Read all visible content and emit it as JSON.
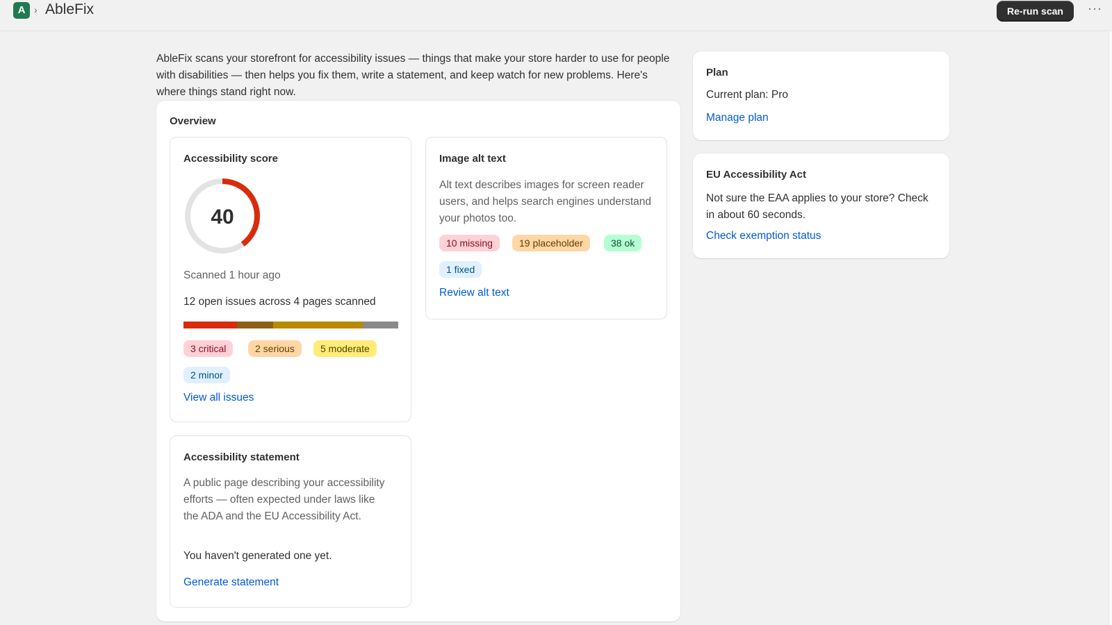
{
  "app": {
    "logo_letter": "A",
    "title": "AbleFix"
  },
  "header": {
    "rerun_label": "Re-run scan",
    "more_label": "···"
  },
  "intro": "AbleFix scans your storefront for accessibility issues — things that make your store harder to use for people with disabilities — then helps you fix them, write a statement, and keep watch for new problems. Here's where things stand right now.",
  "overview": {
    "title": "Overview",
    "score_card": {
      "title": "Accessibility score",
      "score": "40",
      "score_fraction": 0.4,
      "scanned": "Scanned 1 hour ago",
      "issues_summary": "12 open issues across 4 pages scanned",
      "severity_counts": {
        "critical": 3,
        "serious": 2,
        "moderate": 5,
        "minor": 2
      },
      "severity_colors": {
        "critical": "#d82c0d",
        "serious": "#8a6116",
        "moderate": "#b98900",
        "minor": "#8a8a8a"
      },
      "badges": {
        "critical": "3 critical",
        "serious": "2 serious",
        "moderate": "5 moderate",
        "minor": "2 minor"
      },
      "link": "View all issues"
    },
    "alt_card": {
      "title": "Image alt text",
      "description": "Alt text describes images for screen reader users, and helps search engines understand your photos too.",
      "badges": {
        "missing": "10 missing",
        "placeholder": "19 placeholder",
        "ok": "38 ok",
        "fixed": "1 fixed"
      },
      "link": "Review alt text"
    },
    "statement_card": {
      "title": "Accessibility statement",
      "description": "A public page describing your accessibility efforts — often expected under laws like the ADA and the EU Accessibility Act.",
      "status": "You haven't generated one yet.",
      "link": "Generate statement"
    }
  },
  "plan": {
    "title": "Plan",
    "current": "Current plan: Pro",
    "link": "Manage plan"
  },
  "eaa": {
    "title": "EU Accessibility Act",
    "description": "Not sure the EAA applies to your store? Check in about 60 seconds.",
    "link": "Check exemption status"
  },
  "colors": {
    "accent_link": "#005bd3",
    "primary_button": "#303030",
    "score_ring": "#d82c0d",
    "ring_track": "#e3e3e3"
  }
}
